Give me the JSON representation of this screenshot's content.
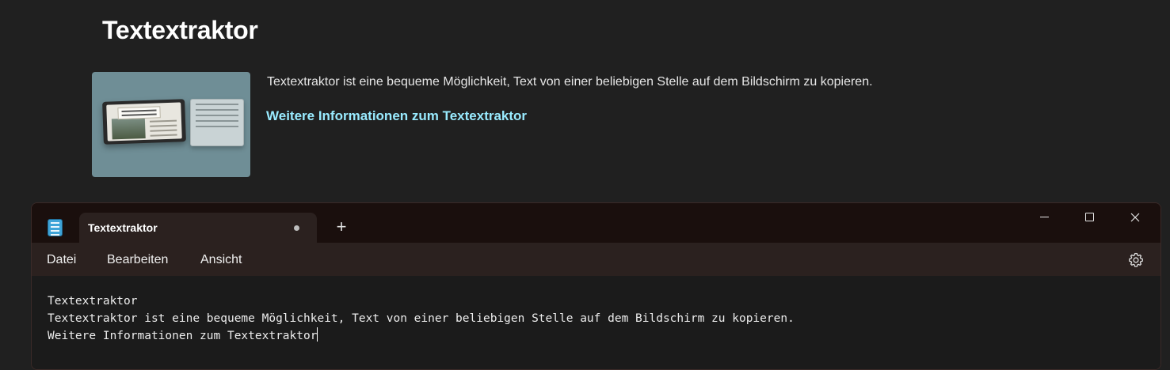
{
  "page": {
    "title": "Textextraktor",
    "description": "Textextraktor ist eine bequeme Möglichkeit, Text von einer beliebigen Stelle auf dem Bildschirm zu kopieren.",
    "link_label": "Weitere Informationen zum Textextraktor"
  },
  "colors": {
    "link": "#99ebff",
    "background": "#202020",
    "notepad_titlebar": "#1a0f0d",
    "notepad_menubar": "#2b211f"
  },
  "notepad": {
    "app_icon": "notepad-icon",
    "tab_title": "Textextraktor",
    "unsaved_indicator": "dot-icon",
    "new_tab_symbol": "+",
    "window_controls": [
      "minimize-icon",
      "maximize-icon",
      "close-icon"
    ],
    "menu": [
      "Datei",
      "Bearbeiten",
      "Ansicht"
    ],
    "settings_icon": "gear-icon",
    "lines": [
      "Textextraktor",
      "Textextraktor ist eine bequeme Möglichkeit, Text von einer beliebigen Stelle auf dem Bildschirm zu kopieren.",
      "Weitere Informationen zum Textextraktor"
    ]
  }
}
